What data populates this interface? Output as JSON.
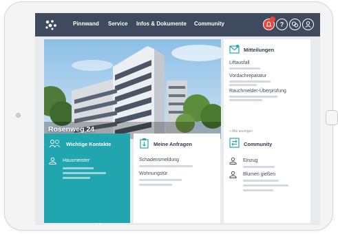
{
  "nav": {
    "items": [
      {
        "label": "Pinnwand"
      },
      {
        "label": "Service"
      },
      {
        "label": "Infos & Dokumente"
      },
      {
        "label": "Community"
      }
    ],
    "icons": [
      "notification-icon",
      "help-icon",
      "chat-icon",
      "user-icon"
    ],
    "badge_color": "#e8463b"
  },
  "hero": {
    "title": "Rosenweg 24"
  },
  "mitteilungen": {
    "title": "Mitteilungen",
    "items": [
      "Liftausfall",
      "Vordachreparatur",
      "Rauchmelder-Überprüfung"
    ],
    "link": "» Alle anzeigen"
  },
  "kontakte": {
    "title": "Wichtige Kontakte",
    "items": [
      "Hausmeister"
    ],
    "slides_total": 2,
    "slide_active": 2
  },
  "anfragen": {
    "title": "Meine Anfragen",
    "items": [
      "Schadensmeldung",
      "Wohnungstür"
    ]
  },
  "community": {
    "title": "Community",
    "items": [
      "Einzug",
      "Blumen gießen"
    ]
  },
  "colors": {
    "nav": "#3f4a5f",
    "accent": "#21a5ae",
    "background": "#e8eaee"
  }
}
